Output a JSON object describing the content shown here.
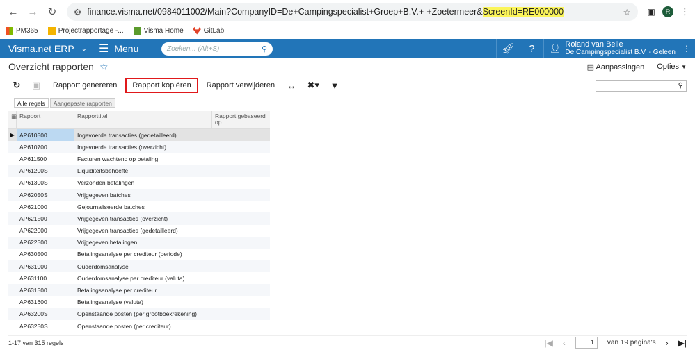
{
  "browser": {
    "url_main": "finance.visma.net/0984011002/Main?CompanyID=De+Campingspecialist+Groep+B.V.+-+Zoetermeer&",
    "url_highlight": "ScreenId=RE000000",
    "profile_initial": "R"
  },
  "bookmarks": [
    {
      "label": "PM365",
      "icon": "windows-icon"
    },
    {
      "label": "Projectrapportage -...",
      "icon": "page-icon"
    },
    {
      "label": "Visma Home",
      "icon": "home-icon"
    },
    {
      "label": "GitLab",
      "icon": "gitlab-icon"
    }
  ],
  "header": {
    "app_name": "Visma.net ERP",
    "menu_label": "Menu",
    "search_placeholder": "Zoeken... (Alt+S)",
    "user_name": "Roland van Belle",
    "user_company": "De Campingspecialist B.V. - Geleen",
    "accent": "#2275b8"
  },
  "page": {
    "title": "Overzicht rapporten",
    "customizations": "Aanpassingen",
    "options": "Opties"
  },
  "toolbar": {
    "generate": "Rapport genereren",
    "copy": "Rapport kopiëren",
    "delete": "Rapport verwijderen"
  },
  "tabs": [
    "Alle regels",
    "Aangepaste rapporten"
  ],
  "columns": {
    "report": "Rapport",
    "title": "Rapporttitel",
    "based_on": "Rapport gebaseerd op"
  },
  "rows": [
    {
      "code": "AP610500",
      "title": "Ingevoerde transacties (gedetailleerd)"
    },
    {
      "code": "AP610700",
      "title": "Ingevoerde transacties (overzicht)"
    },
    {
      "code": "AP611500",
      "title": "Facturen wachtend op betaling"
    },
    {
      "code": "AP61200S",
      "title": "Liquiditeitsbehoefte"
    },
    {
      "code": "AP61300S",
      "title": "Verzonden betalingen"
    },
    {
      "code": "AP62050S",
      "title": "Vrijgegeven batches"
    },
    {
      "code": "AP621000",
      "title": "Gejournaliseerde batches"
    },
    {
      "code": "AP621500",
      "title": "Vrijgegeven transacties (overzicht)"
    },
    {
      "code": "AP622000",
      "title": "Vrijgegeven transacties (gedetailleerd)"
    },
    {
      "code": "AP622500",
      "title": "Vrijgegeven betalingen"
    },
    {
      "code": "AP630500",
      "title": "Betalingsanalyse per crediteur (periode)"
    },
    {
      "code": "AP631000",
      "title": "Ouderdomsanalyse"
    },
    {
      "code": "AP631100",
      "title": "Ouderdomsanalyse per crediteur (valuta)"
    },
    {
      "code": "AP631500",
      "title": "Betalingsanalyse per crediteur"
    },
    {
      "code": "AP631600",
      "title": "Betalingsanalyse (valuta)"
    },
    {
      "code": "AP63200S",
      "title": "Openstaande posten (per grootboekrekening)"
    },
    {
      "code": "AP63250S",
      "title": "Openstaande posten (per crediteur)"
    }
  ],
  "footer": {
    "count": "1-17 van 315 regels",
    "page": "1",
    "page_total": "van 19 pagina's"
  }
}
